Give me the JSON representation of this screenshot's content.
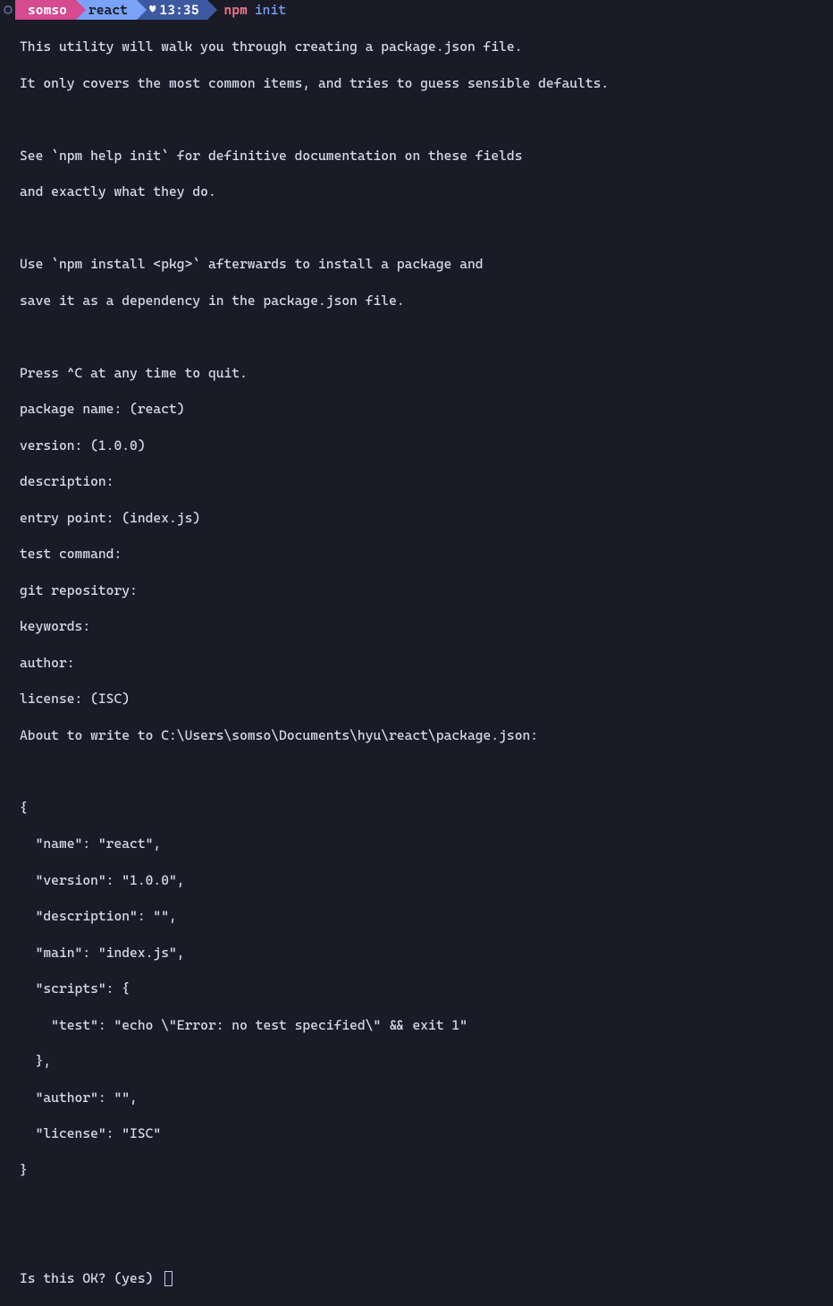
{
  "prompt": {
    "cut_segment": "",
    "user": "somso",
    "dir": "react",
    "heart": "♥",
    "time": "13:35",
    "command_exec": "npm",
    "command_arg": "init"
  },
  "output": {
    "line01": "This utility will walk you through creating a package.json file.",
    "line02": "It only covers the most common items, and tries to guess sensible defaults.",
    "line03": "",
    "line04": "See `npm help init` for definitive documentation on these fields",
    "line05": "and exactly what they do.",
    "line06": "",
    "line07": "Use `npm install <pkg>` afterwards to install a package and",
    "line08": "save it as a dependency in the package.json file.",
    "line09": "",
    "line10": "Press ^C at any time to quit.",
    "line11": "package name: (react)",
    "line12": "version: (1.0.0)",
    "line13": "description:",
    "line14": "entry point: (index.js)",
    "line15": "test command:",
    "line16": "git repository:",
    "line17": "keywords:",
    "line18": "author:",
    "line19": "license: (ISC)",
    "line20": "About to write to C:\\Users\\somso\\Documents\\hyu\\react\\package.json:",
    "line21": "",
    "line22": "{",
    "line23": "  \"name\": \"react\",",
    "line24": "  \"version\": \"1.0.0\",",
    "line25": "  \"description\": \"\",",
    "line26": "  \"main\": \"index.js\",",
    "line27": "  \"scripts\": {",
    "line28": "    \"test\": \"echo \\\"Error: no test specified\\\" && exit 1\"",
    "line29": "  },",
    "line30": "  \"author\": \"\",",
    "line31": "  \"license\": \"ISC\"",
    "line32": "}",
    "line33": "",
    "line34": "",
    "prompt_final": "Is this OK? (yes) "
  }
}
